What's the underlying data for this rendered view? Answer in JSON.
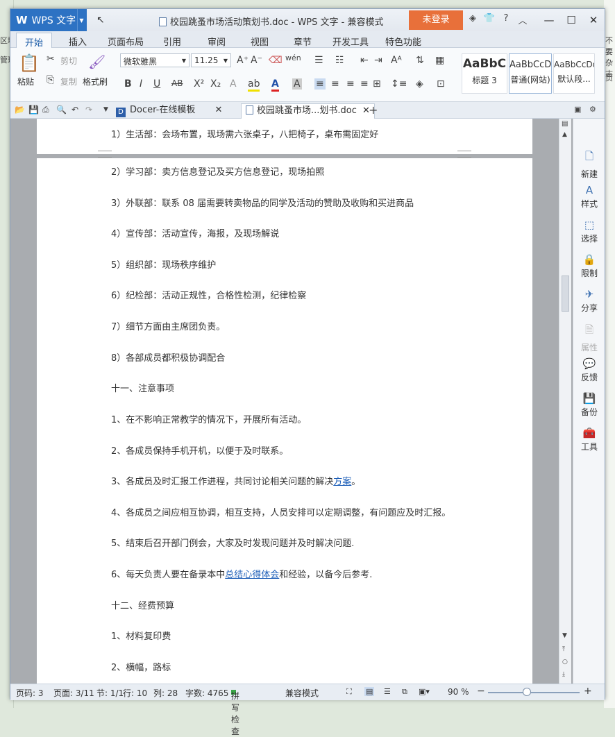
{
  "background": {
    "left_text": [
      "区域",
      "管理"
    ],
    "right_text": [
      "不要",
      "杂志",
      "页"
    ]
  },
  "titlebar": {
    "app_label": "WPS 文字",
    "doc_title": "校园跳蚤市场活动策划书.doc - WPS 文字 - 兼容模式",
    "login_label": "未登录"
  },
  "ribbon_tabs": [
    "开始",
    "插入",
    "页面布局",
    "引用",
    "审阅",
    "视图",
    "章节",
    "开发工具",
    "特色功能"
  ],
  "ribbon": {
    "paste": "粘贴",
    "cut": "剪切",
    "copy": "复制",
    "format_painter": "格式刷",
    "font_name": "微软雅黑",
    "font_size": "11.25",
    "styles": [
      {
        "preview": "AaBbC",
        "label": "标题 3"
      },
      {
        "preview": "AaBbCcD",
        "label": "普通(网站)"
      },
      {
        "preview": "AaBbCcDd",
        "label": "默认段..."
      }
    ]
  },
  "tabs": {
    "docer": "Docer-在线模板",
    "document": "校园跳蚤市场...划书.doc"
  },
  "document": {
    "lines": [
      "1）生活部：会场布置，现场需六张桌子，八把椅子，桌布需固定好",
      "2）学习部：卖方信息登记及买方信息登记，现场拍照",
      "3）外联部：联系 08 届需要转卖物品的同学及活动的赞助及收购和买进商品",
      "4）宣传部：活动宣传，海报，及现场解说",
      "5）组织部：现场秩序维护",
      "6）纪检部：活动正规性，合格性检测，纪律检察",
      "7）细节方面由主席团负责。",
      "8）各部成员都积极协调配合",
      "十一、注意事项",
      "1、在不影响正常教学的情况下，开展所有活动。",
      "2、各成员保持手机开机，以便于及时联系。",
      "3、各成员及时汇报工作进程，共同讨论相关问题的解决",
      "4、各成员之间应相互协调，相互支持，人员安排可以定期调整，有问题应及时汇报。",
      "5、结束后召开部门例会，大家及时发现问题并及时解决问题.",
      "6、每天负责人要在备录本中",
      "十二、经费预算",
      "1、材料复印费",
      "2、横幅，路标"
    ],
    "line3_link": "方案",
    "line3_tail": "。",
    "line15_link": "总结心得体会",
    "line15_tail": "和经验，以备今后参考."
  },
  "sidepane": [
    {
      "icon": "new-icon",
      "label": "新建"
    },
    {
      "icon": "style-icon",
      "label": "样式"
    },
    {
      "icon": "select-icon",
      "label": "选择"
    },
    {
      "icon": "restrict-icon",
      "label": "限制"
    },
    {
      "icon": "share-icon",
      "label": "分享"
    },
    {
      "icon": "properties-icon",
      "label": "属性"
    },
    {
      "icon": "feedback-icon",
      "label": "反馈"
    },
    {
      "icon": "backup-icon",
      "label": "备份"
    },
    {
      "icon": "tools-icon",
      "label": "工具"
    }
  ],
  "status": {
    "page_no": "页码: 3",
    "pages": "页面: 3/11",
    "section": "节: 1/1",
    "row": "行: 10",
    "col": "列: 28",
    "words": "字数: 4765",
    "spell": "拼写检查",
    "compat": "兼容模式",
    "zoom": "90 %"
  },
  "colors": {
    "accent": "#2d72c3",
    "login": "#e8703a",
    "link": "#1e5fb8"
  }
}
